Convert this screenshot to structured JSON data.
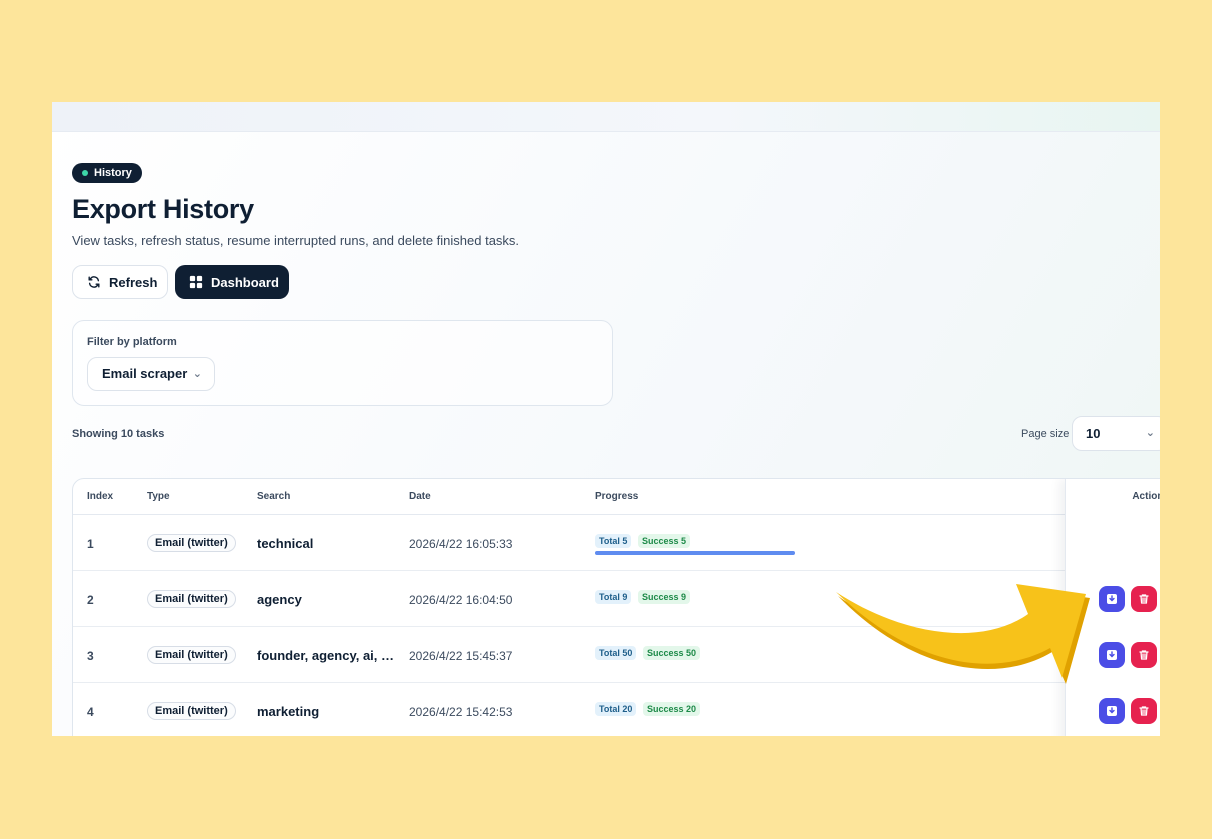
{
  "page": {
    "badge": "History",
    "title": "Export History",
    "subtitle": "View tasks, refresh status, resume interrupted runs, and delete finished tasks."
  },
  "toolbar": {
    "refresh_label": "Refresh",
    "dashboard_label": "Dashboard"
  },
  "filter": {
    "label": "Filter by platform",
    "selected": "Email scraper"
  },
  "summary": {
    "showing": "Showing 10 tasks",
    "page_size_label": "Page size",
    "page_size": "10"
  },
  "table": {
    "headers": {
      "index": "Index",
      "type": "Type",
      "search": "Search",
      "date": "Date",
      "progress": "Progress",
      "actions": "Actions"
    },
    "rows": [
      {
        "index": "1",
        "type": "Email (twitter)",
        "search": "technical",
        "date": "2026/4/22 16:05:33",
        "total": "Total 5",
        "success": "Success 5",
        "progress": 1.0
      },
      {
        "index": "2",
        "type": "Email (twitter)",
        "search": "agency",
        "date": "2026/4/22 16:04:50",
        "total": "Total 9",
        "success": "Success 9"
      },
      {
        "index": "3",
        "type": "Email (twitter)",
        "search": "founder, agency, ai, cr…",
        "date": "2026/4/22 15:45:37",
        "total": "Total 50",
        "success": "Success 50"
      },
      {
        "index": "4",
        "type": "Email (twitter)",
        "search": "marketing",
        "date": "2026/4/22 15:42:53",
        "total": "Total 20",
        "success": "Success 20"
      }
    ]
  },
  "colors": {
    "background": "#fde59b",
    "primary_dark": "#0f1f33",
    "download_button": "#4b4de6",
    "delete_button": "#e6224f",
    "arrow": "#f7c21a"
  },
  "icons": {
    "refresh": "refresh-icon",
    "dashboard": "grid-icon",
    "download": "download-icon",
    "delete": "trash-icon",
    "annotation": "arrow-icon"
  }
}
